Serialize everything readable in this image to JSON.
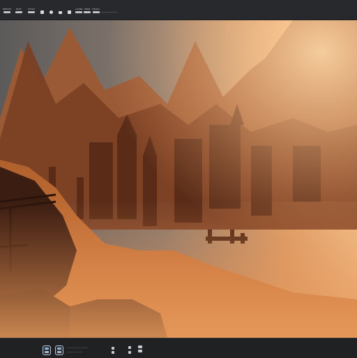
{
  "toolbar": {
    "items": [
      {
        "label": "PRESET"
      },
      {
        "label": "EDIT"
      },
      {
        "label": "STYLE"
      },
      {
        "label": "LAYER"
      },
      {
        "label": "VIEW"
      },
      {
        "label": "TOOLS"
      }
    ],
    "icons": [
      "brush-icon",
      "circle-tool-icon",
      "menu-icon",
      "download-icon"
    ]
  },
  "canvas": {
    "image": "fantasy-mountain-city-painting"
  },
  "dock": {
    "icons": [
      "app-icon-1",
      "app-icon-2"
    ],
    "labels": [
      "~~~~ ~~~~ ~~~",
      "~~~~ ~~ ~~"
    ]
  }
}
